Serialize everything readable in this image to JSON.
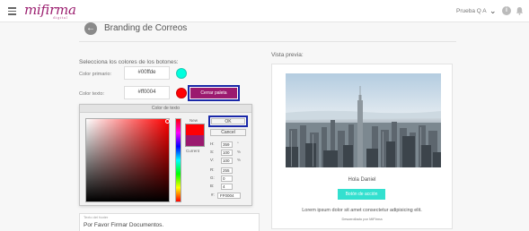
{
  "topbar": {
    "logo_text": "mifirma",
    "logo_tagline": "digital",
    "user_name": "Prueba Q A",
    "colors": {
      "brand": "#9b1e6f"
    }
  },
  "header": {
    "title": "Branding de Correos"
  },
  "form": {
    "section_label": "Selecciona los colores de los botones:",
    "primary_label": "Color primario:",
    "primary_value": "#00ffde",
    "primary_color": "#00ffde",
    "text_label": "Color texto:",
    "text_value": "#ff0004",
    "text_color": "#ff0004",
    "close_palette_label": "Cerrar paleta",
    "textarea_label": "Texto del footer",
    "textarea_value": "Por Favor Firmar Documentos."
  },
  "color_dialog": {
    "title": "Color de texto",
    "new_label": "New",
    "current_label": "Current",
    "ok_label": "OK",
    "cancel_label": "Cancel",
    "new_color": "#ff0004",
    "current_color": "#9b1a6f",
    "fields": [
      {
        "label": "H:",
        "value": "359",
        "unit": "°"
      },
      {
        "label": "S:",
        "value": "100",
        "unit": "%"
      },
      {
        "label": "V:",
        "value": "100",
        "unit": "%"
      },
      {
        "label": "R:",
        "value": "255",
        "unit": ""
      },
      {
        "label": "G:",
        "value": "0",
        "unit": ""
      },
      {
        "label": "B:",
        "value": "4",
        "unit": ""
      }
    ],
    "hex_label": "#:",
    "hex_value": "FF0004"
  },
  "preview": {
    "label": "Vista previa:",
    "greeting": "Hola Daniel",
    "button_label": "Botón de acción",
    "body_text": "Lorem ipsum dolor sit amet consectetur adipisicing elit.",
    "powered_by": "Desarrollado por MiFirma",
    "button_color": "#33e0cf"
  }
}
